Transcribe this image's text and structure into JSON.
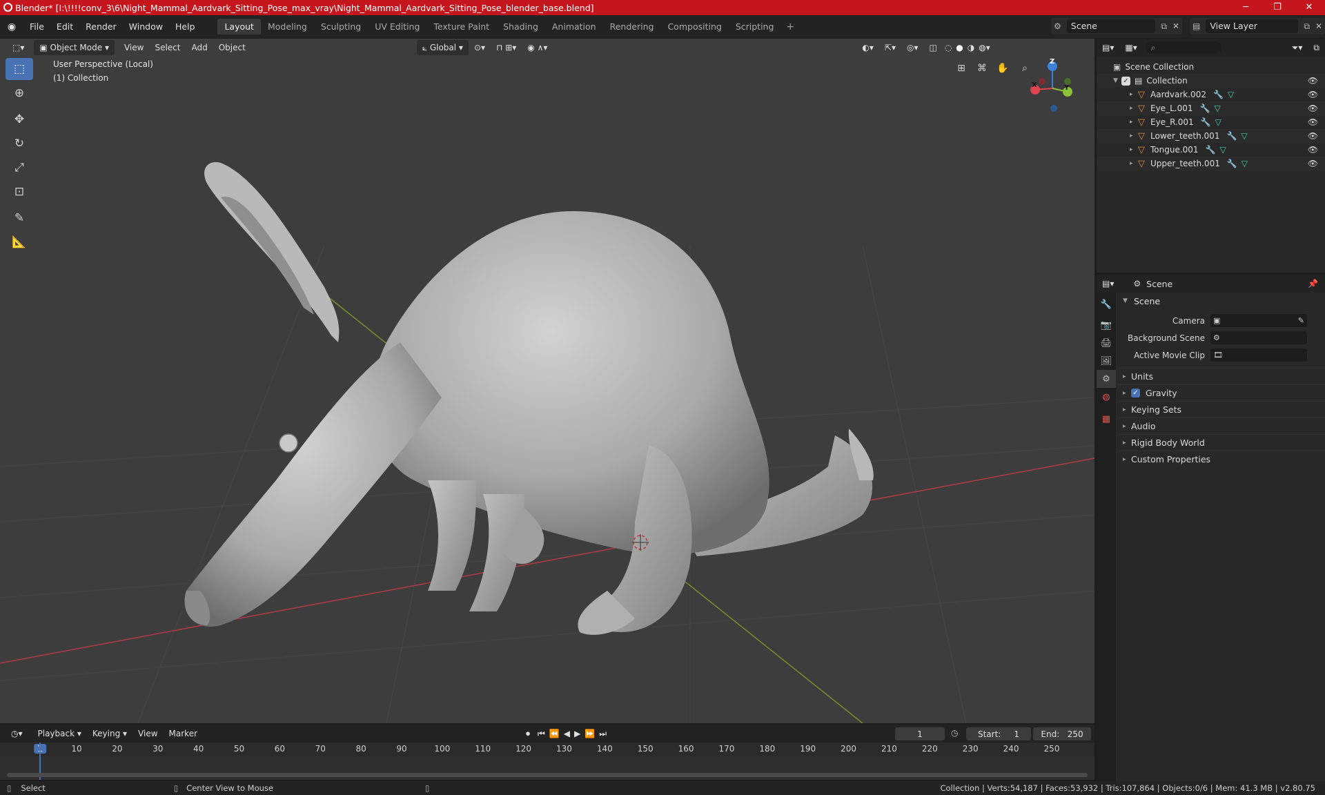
{
  "titlebar": {
    "title": "Blender* [I:\\!!!!conv_3\\6\\Night_Mammal_Aardvark_Sitting_Pose_max_vray\\Night_Mammal_Aardvark_Sitting_Pose_blender_base.blend]",
    "minimize": "─",
    "maximize": "❐",
    "close": "✕"
  },
  "menubar": {
    "menus": [
      "File",
      "Edit",
      "Render",
      "Window",
      "Help"
    ],
    "workspaces": [
      "Layout",
      "Modeling",
      "Sculpting",
      "UV Editing",
      "Texture Paint",
      "Shading",
      "Animation",
      "Rendering",
      "Compositing",
      "Scripting"
    ],
    "active_workspace": "Layout",
    "add_workspace": "+",
    "scene": "Scene",
    "view_layer": "View Layer"
  },
  "viewport": {
    "mode": "Object Mode",
    "menus": [
      "View",
      "Select",
      "Add",
      "Object"
    ],
    "transform_orientation": "Global",
    "perspective_label": "User Perspective (Local)",
    "collection_label": "(1) Collection",
    "gizmo": {
      "x": "X",
      "y": "Y",
      "z": "Z"
    }
  },
  "outliner": {
    "search_placeholder": "",
    "root": "Scene Collection",
    "collection": "Collection",
    "objects": [
      "Aardvark.002",
      "Eye_L.001",
      "Eye_R.001",
      "Lower_teeth.001",
      "Tongue.001",
      "Upper_teeth.001"
    ]
  },
  "properties": {
    "context": "Scene",
    "panel_title": "Scene",
    "fields": [
      {
        "label": "Camera",
        "value": ""
      },
      {
        "label": "Background Scene",
        "value": ""
      },
      {
        "label": "Active Movie Clip",
        "value": ""
      }
    ],
    "subpanels": [
      "Units",
      "Gravity",
      "Keying Sets",
      "Audio",
      "Rigid Body World",
      "Custom Properties"
    ],
    "gravity_checked": true
  },
  "timeline": {
    "menus": [
      "Playback",
      "Keying",
      "View",
      "Marker"
    ],
    "current_frame": "1",
    "start_label": "Start:",
    "start": "1",
    "end_label": "End:",
    "end": "250",
    "ticks": [
      "1",
      "10",
      "20",
      "30",
      "40",
      "50",
      "60",
      "70",
      "80",
      "90",
      "100",
      "110",
      "120",
      "130",
      "140",
      "150",
      "160",
      "170",
      "180",
      "190",
      "200",
      "210",
      "220",
      "230",
      "240",
      "250"
    ]
  },
  "statusbar": {
    "left_action": "Select",
    "middle_action": "Center View to Mouse",
    "stats": "Collection | Verts:54,187 | Faces:53,932 | Tris:107,864 | Objects:0/6 | Mem: 41.3 MB | v2.80.75"
  },
  "colors": {
    "titlebar": "#c4161c",
    "accent": "#4772b3",
    "x_axis": "#e0424f",
    "y_axis": "#8ac436",
    "z_axis": "#3b82d8"
  }
}
